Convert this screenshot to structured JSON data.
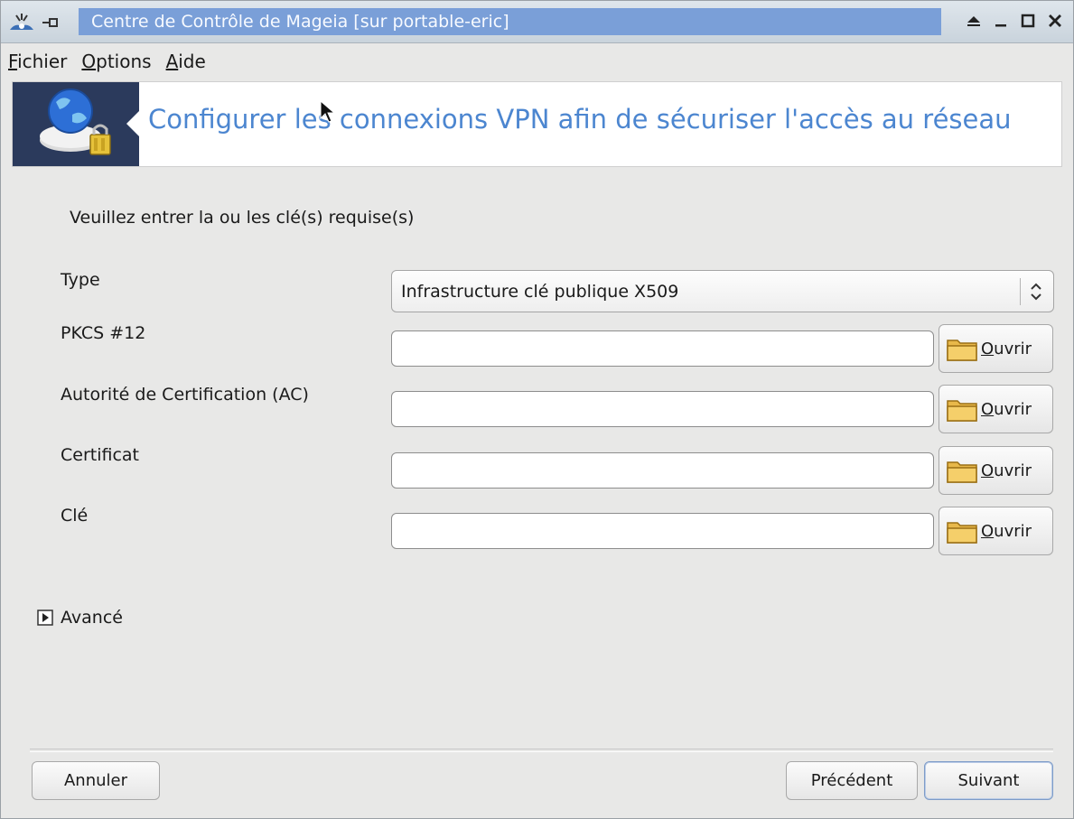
{
  "window": {
    "title": "Centre de Contrôle de Mageia  [sur portable-eric]",
    "buttons": [
      "shade-icon",
      "minimize-icon",
      "maximize-icon",
      "close-icon"
    ]
  },
  "menubar": {
    "items": [
      {
        "label": "Fichier",
        "mnemonic": "F"
      },
      {
        "label": "Options",
        "mnemonic": "O"
      },
      {
        "label": "Aide",
        "mnemonic": "A"
      }
    ]
  },
  "banner": {
    "title": "Configurer les connexions VPN afin de sécuriser l'accès au réseau",
    "icon": "network-globe-lock-icon",
    "title_color": "#4c86d0"
  },
  "content": {
    "instruction": "Veuillez entrer la ou les clé(s) requise(s)",
    "type_label": "Type",
    "type_value": "Infrastructure clé publique X509",
    "fields": [
      {
        "label": "PKCS #12",
        "value": "",
        "button": "Ouvrir"
      },
      {
        "label": "Autorité de Certification (AC)",
        "value": "",
        "button": "Ouvrir"
      },
      {
        "label": "Certificat",
        "value": "",
        "button": "Ouvrir"
      },
      {
        "label": "Clé",
        "value": "",
        "button": "Ouvrir"
      }
    ],
    "advanced_label": "Avancé"
  },
  "footer": {
    "cancel": "Annuler",
    "previous": "Précédent",
    "next": "Suivant"
  }
}
